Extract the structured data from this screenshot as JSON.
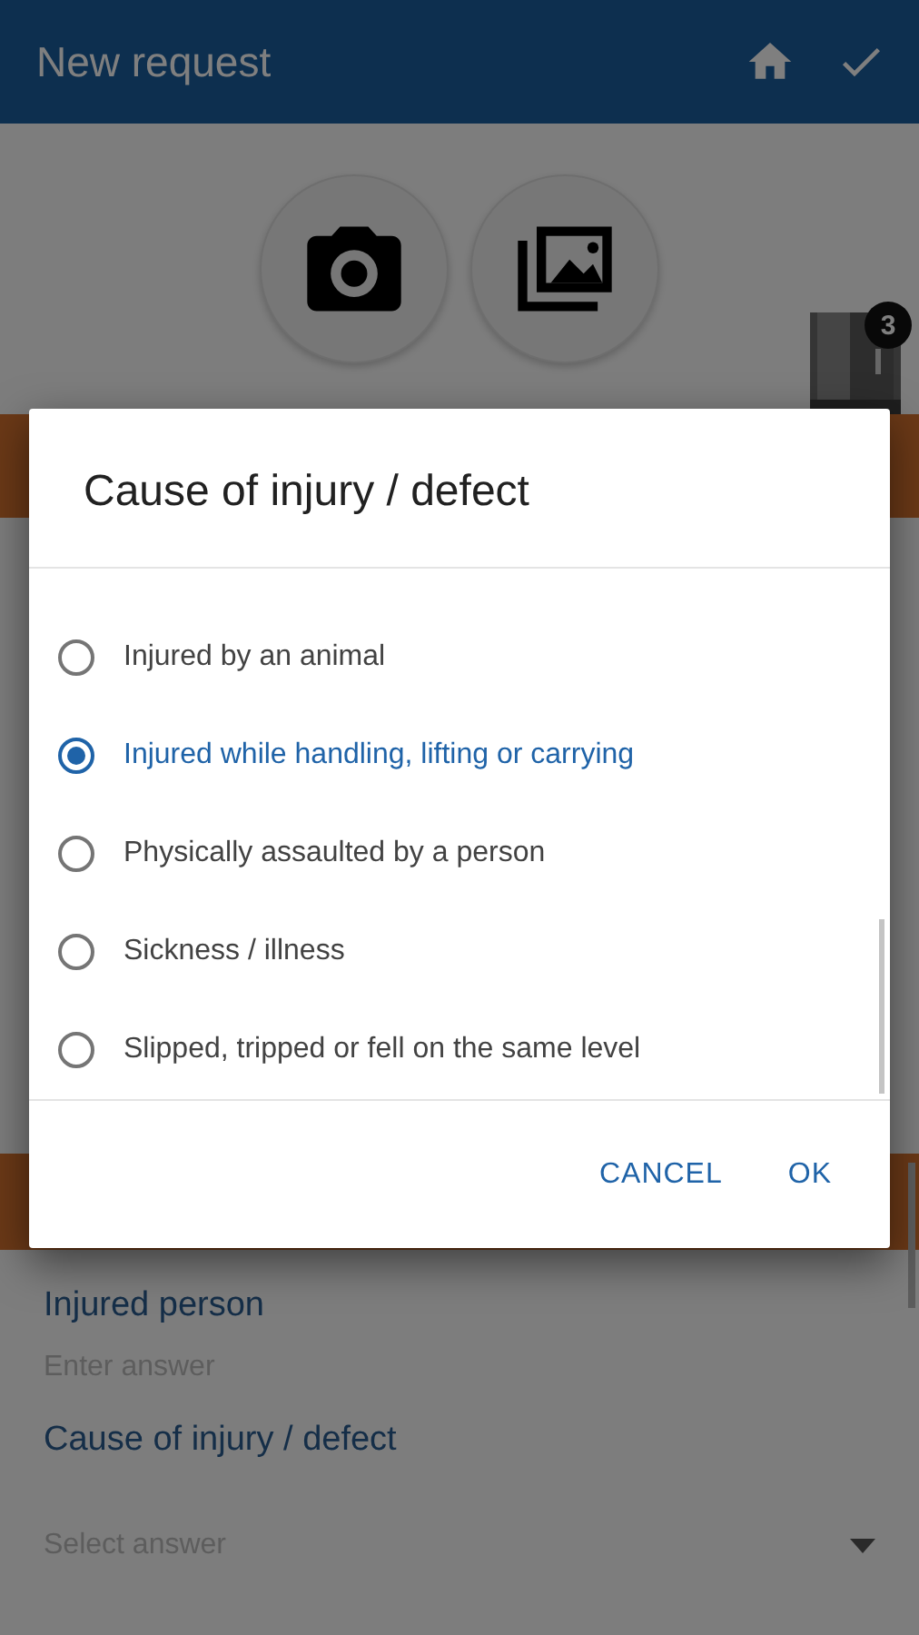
{
  "app_bar": {
    "title": "New request"
  },
  "photos": {
    "count_badge": "3"
  },
  "fields": [
    {
      "kind": "text",
      "label": "Injured person",
      "placeholder": "Enter answer"
    },
    {
      "kind": "select",
      "label": "Cause of injury / defect",
      "placeholder": "Select answer"
    }
  ],
  "dialog": {
    "title": "Cause of injury / defect",
    "options": [
      {
        "label": "Injured by an animal",
        "selected": false
      },
      {
        "label": "Injured while handling, lifting or carrying",
        "selected": true
      },
      {
        "label": "Physically assaulted by a person",
        "selected": false
      },
      {
        "label": "Sickness / illness",
        "selected": false
      },
      {
        "label": "Slipped, tripped or fell on the same level",
        "selected": false
      }
    ],
    "buttons": [
      "CANCEL",
      "OK"
    ]
  }
}
